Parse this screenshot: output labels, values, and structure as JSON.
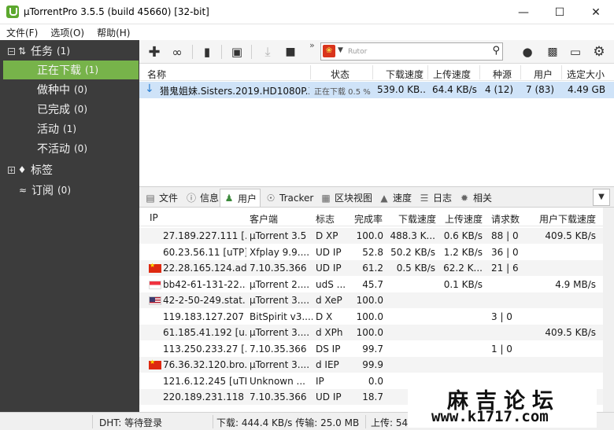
{
  "window": {
    "title": "µTorrentPro 3.5.5  (build 45660) [32-bit]",
    "min_icon": "minimize-icon",
    "max_icon": "maximize-icon",
    "close_icon": "close-icon"
  },
  "menu": [
    "文件(F)",
    "选项(O)",
    "帮助(H)"
  ],
  "sidebar": {
    "tasks": {
      "label": "任务",
      "count": "(1)"
    },
    "items": [
      {
        "label": "正在下载",
        "count": "(1)",
        "active": true
      },
      {
        "label": "做种中",
        "count": "(0)"
      },
      {
        "label": "已完成",
        "count": "(0)"
      },
      {
        "label": "活动",
        "count": "(1)"
      },
      {
        "label": "不活动",
        "count": "(0)"
      }
    ],
    "labels": {
      "label": "标签"
    },
    "feeds": {
      "label": "订阅",
      "count": "(0)"
    }
  },
  "toolbar": {
    "overflow": "»",
    "search_placeholder": "Rutor",
    "icons": [
      "add-icon",
      "add-link-icon",
      "create-torrent-icon",
      "delete-icon",
      "start-icon",
      "stop-icon",
      "bulb-icon",
      "chat-icon",
      "remote-icon",
      "settings-icon"
    ]
  },
  "torrent_list": {
    "columns": [
      "名称",
      "状态",
      "下载速度",
      "上传速度",
      "种源",
      "用户",
      "选定大小"
    ],
    "rows": [
      {
        "name": "猎鬼姐妹.Sisters.2019.HD1080P.X...",
        "status": "正在下载 0.5 %",
        "progress": 0.5,
        "down": "539.0 KB...",
        "up": "64.4 KB/s",
        "seeds": "4 (12)",
        "peers": "7 (83)",
        "size": "4.49 GB"
      }
    ]
  },
  "tabs": [
    {
      "label": "文件",
      "icon": "files-icon"
    },
    {
      "label": "信息",
      "icon": "info-icon"
    },
    {
      "label": "用户",
      "icon": "peers-icon",
      "active": true
    },
    {
      "label": "Tracker",
      "icon": "tracker-icon"
    },
    {
      "label": "区块视图",
      "icon": "pieces-icon"
    },
    {
      "label": "速度",
      "icon": "speed-icon"
    },
    {
      "label": "日志",
      "icon": "log-icon"
    },
    {
      "label": "相关",
      "icon": "related-icon"
    }
  ],
  "peers": {
    "columns": [
      "IP",
      "客户端",
      "标志",
      "完成率",
      "下载速度",
      "上传速度",
      "请求数",
      "用户下载速度"
    ],
    "rows": [
      {
        "flag": "",
        "ip": "27.189.227.111 [...",
        "client": "µTorrent 3.5",
        "flags": "D XP",
        "pct": "100.0",
        "down": "488.3 K...",
        "up": "0.6 KB/s",
        "req": "88 | 0",
        "peer_dl": "409.5 KB/s"
      },
      {
        "flag": "",
        "ip": "60.23.56.11 [uTP]",
        "client": "Xfplay 9.9....",
        "flags": "UD IP",
        "pct": "52.8",
        "down": "50.2 KB/s",
        "up": "1.2 KB/s",
        "req": "36 | 0",
        "peer_dl": ""
      },
      {
        "flag": "cn",
        "ip": "22.28.165.124.ad...",
        "client": "7.10.35.366",
        "flags": "UD IP",
        "pct": "61.2",
        "down": "0.5 KB/s",
        "up": "62.2 K...",
        "req": "21 | 6",
        "peer_dl": ""
      },
      {
        "flag": "sg",
        "ip": "bb42-61-131-22...",
        "client": "µTorrent 2....",
        "flags": "udS ...",
        "pct": "45.7",
        "down": "",
        "up": "0.1 KB/s",
        "req": "",
        "peer_dl": "4.9 MB/s"
      },
      {
        "flag": "us",
        "ip": "42-2-50-249.stat...",
        "client": "µTorrent 3....",
        "flags": "d XeP",
        "pct": "100.0",
        "down": "",
        "up": "",
        "req": "",
        "peer_dl": ""
      },
      {
        "flag": "",
        "ip": "119.183.127.207",
        "client": "BitSpirit v3....",
        "flags": "D X",
        "pct": "100.0",
        "down": "",
        "up": "",
        "req": "3 | 0",
        "peer_dl": ""
      },
      {
        "flag": "",
        "ip": "61.185.41.192 [u...",
        "client": "µTorrent 3....",
        "flags": "d XPh",
        "pct": "100.0",
        "down": "",
        "up": "",
        "req": "",
        "peer_dl": "409.5 KB/s"
      },
      {
        "flag": "",
        "ip": "113.250.233.27 [...",
        "client": "7.10.35.366",
        "flags": "DS IP",
        "pct": "99.7",
        "down": "",
        "up": "",
        "req": "1 | 0",
        "peer_dl": ""
      },
      {
        "flag": "cn",
        "ip": "76.36.32.120.bro...",
        "client": "µTorrent 3....",
        "flags": "d IEP",
        "pct": "99.9",
        "down": "",
        "up": "",
        "req": "",
        "peer_dl": ""
      },
      {
        "flag": "",
        "ip": "121.6.12.245 [uTP]",
        "client": "Unknown ...",
        "flags": " IP",
        "pct": "0.0",
        "down": "",
        "up": "",
        "req": "",
        "peer_dl": ""
      },
      {
        "flag": "",
        "ip": "220.189.231.118 ...",
        "client": "7.10.35.366",
        "flags": "UD IP",
        "pct": "18.7",
        "down": "",
        "up": "",
        "req": "",
        "peer_dl": ""
      }
    ]
  },
  "statusbar": {
    "dht": "DHT: 等待登录",
    "down": "下载: 444.4 KB/s 传输: 25.0 MB",
    "up": "上传: 54."
  },
  "watermark": {
    "title": "麻吉论坛",
    "url": "www.k1717.com"
  }
}
